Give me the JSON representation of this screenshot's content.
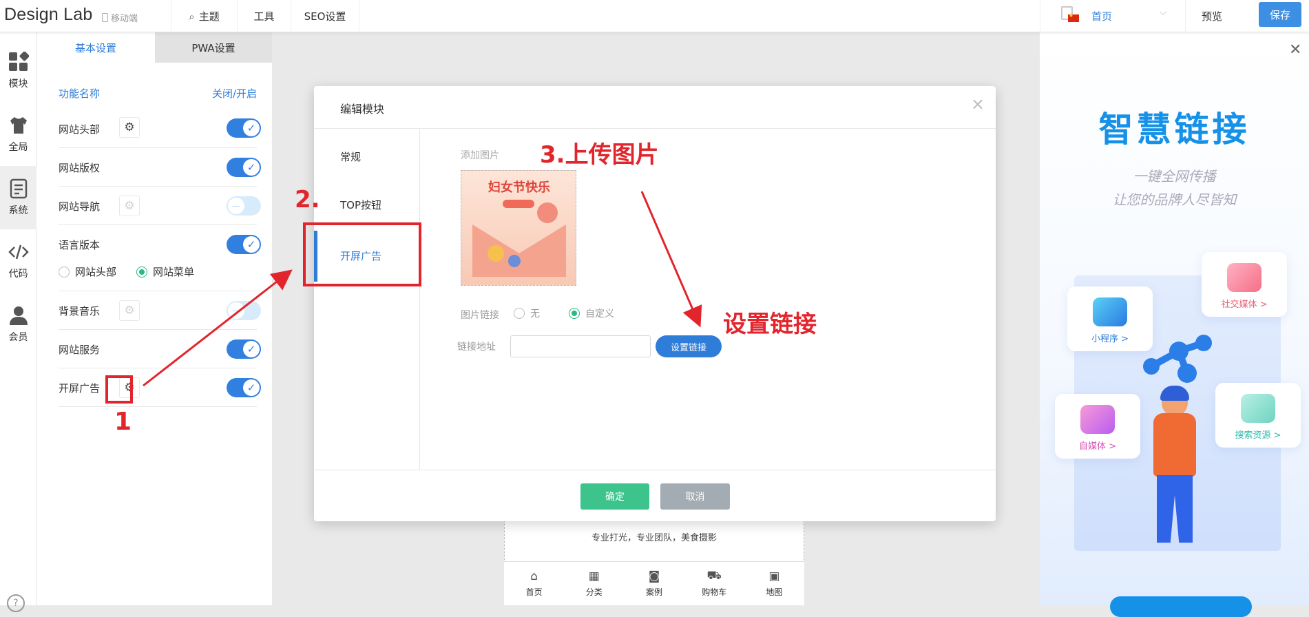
{
  "topbar": {
    "logo": "Design Lab",
    "mobile_label": "移动端",
    "nav": [
      "主题",
      "工具",
      "SEO设置"
    ],
    "language": "首页",
    "preview": "预览",
    "save": "保存"
  },
  "iconbar": {
    "items": [
      {
        "label": "模块",
        "icon": "modules-icon"
      },
      {
        "label": "全局",
        "icon": "shirt-icon"
      },
      {
        "label": "系统",
        "icon": "document-icon",
        "active": true
      },
      {
        "label": "代码",
        "icon": "code-icon"
      },
      {
        "label": "会员",
        "icon": "user-icon"
      }
    ],
    "help": "?"
  },
  "panel": {
    "tabs": [
      "基本设置",
      "PWA设置"
    ],
    "header_name": "功能名称",
    "header_toggle": "关闭/开启",
    "rows": [
      {
        "label": "网站头部",
        "gear": true,
        "gear_enabled": true,
        "on": true
      },
      {
        "label": "网站版权",
        "gear": false,
        "on": true
      },
      {
        "label": "网站导航",
        "gear": true,
        "gear_enabled": false,
        "on": false
      },
      {
        "label": "语言版本",
        "gear": false,
        "on": true
      },
      {
        "label": "背景音乐",
        "gear": true,
        "gear_enabled": false,
        "on": false
      },
      {
        "label": "网站服务",
        "gear": false,
        "on": true
      },
      {
        "label": "开屏广告",
        "gear": true,
        "gear_enabled": true,
        "on": true
      }
    ],
    "language_options": [
      {
        "label": "网站头部",
        "selected": false
      },
      {
        "label": "网站菜单",
        "selected": true
      }
    ]
  },
  "modal": {
    "title": "编辑模块",
    "tabs": [
      "常规",
      "TOP按钮",
      "开屏广告"
    ],
    "active_tab": "开屏广告",
    "add_image_label": "添加图片",
    "image_text": "妇女节快乐",
    "link_label": "图片链接",
    "link_options": [
      {
        "label": "无",
        "selected": false
      },
      {
        "label": "自定义",
        "selected": true
      }
    ],
    "address_label": "链接地址",
    "address_value": "",
    "set_link_button": "设置链接",
    "confirm": "确定",
    "cancel": "取消"
  },
  "phone_preview": {
    "slogan": "专业打光，专业团队，美食摄影",
    "nav": [
      {
        "label": "首页",
        "icon": "home-icon"
      },
      {
        "label": "分类",
        "icon": "grid-icon"
      },
      {
        "label": "案例",
        "icon": "camera-icon"
      },
      {
        "label": "购物车",
        "icon": "cart-icon"
      },
      {
        "label": "地图",
        "icon": "map-icon"
      }
    ]
  },
  "annotations": {
    "step1": "1",
    "step2": "2.",
    "step3": "3.上传图片",
    "set_link": "设置链接"
  },
  "ad": {
    "title": "智慧链接",
    "subtitle1": "一键全网传播",
    "subtitle2": "让您的品牌人尽皆知",
    "cards": [
      "小程序 >",
      "社交媒体 >",
      "自媒体 >",
      "搜索资源 >"
    ]
  },
  "colors": {
    "accent": "#2e7dd8",
    "save": "#3d8fe3",
    "confirm": "#3dc48d",
    "cancel": "#a3acb3",
    "annotation": "#e2252c"
  }
}
